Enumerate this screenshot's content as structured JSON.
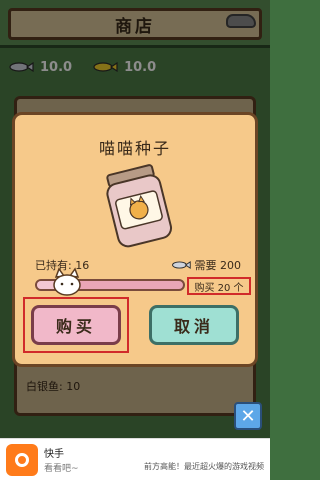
{
  "header": {
    "title": "商店"
  },
  "currency": {
    "silver_fish": "10.0",
    "gold_fish": "10.0"
  },
  "background_list": {
    "item_line_1": "白银鱼: 10"
  },
  "dialog": {
    "title": "喵喵种子",
    "owned_label": "已持有: 16",
    "need_label": "需要 200",
    "buy_count": "购买 20 个",
    "buy_button": "购买",
    "cancel_button": "取消",
    "slider_fraction": 0.2
  },
  "close_button": {
    "label": "✕"
  },
  "ad": {
    "title": "快手",
    "subtitle": "看看吧~",
    "right_text": "前方高能！最近超火爆的游戏视频"
  },
  "colors": {
    "dialog_bg": "#f6c98a",
    "buy_button_bg": "#f1b8c9",
    "cancel_button_bg": "#9fe0d3",
    "highlight_red": "#d12a2a",
    "close_button_bg": "#5da7e8"
  },
  "icons": {
    "fish": "fish-icon",
    "jar": "seed-jar-icon",
    "cat_handle": "cat-face-icon"
  }
}
